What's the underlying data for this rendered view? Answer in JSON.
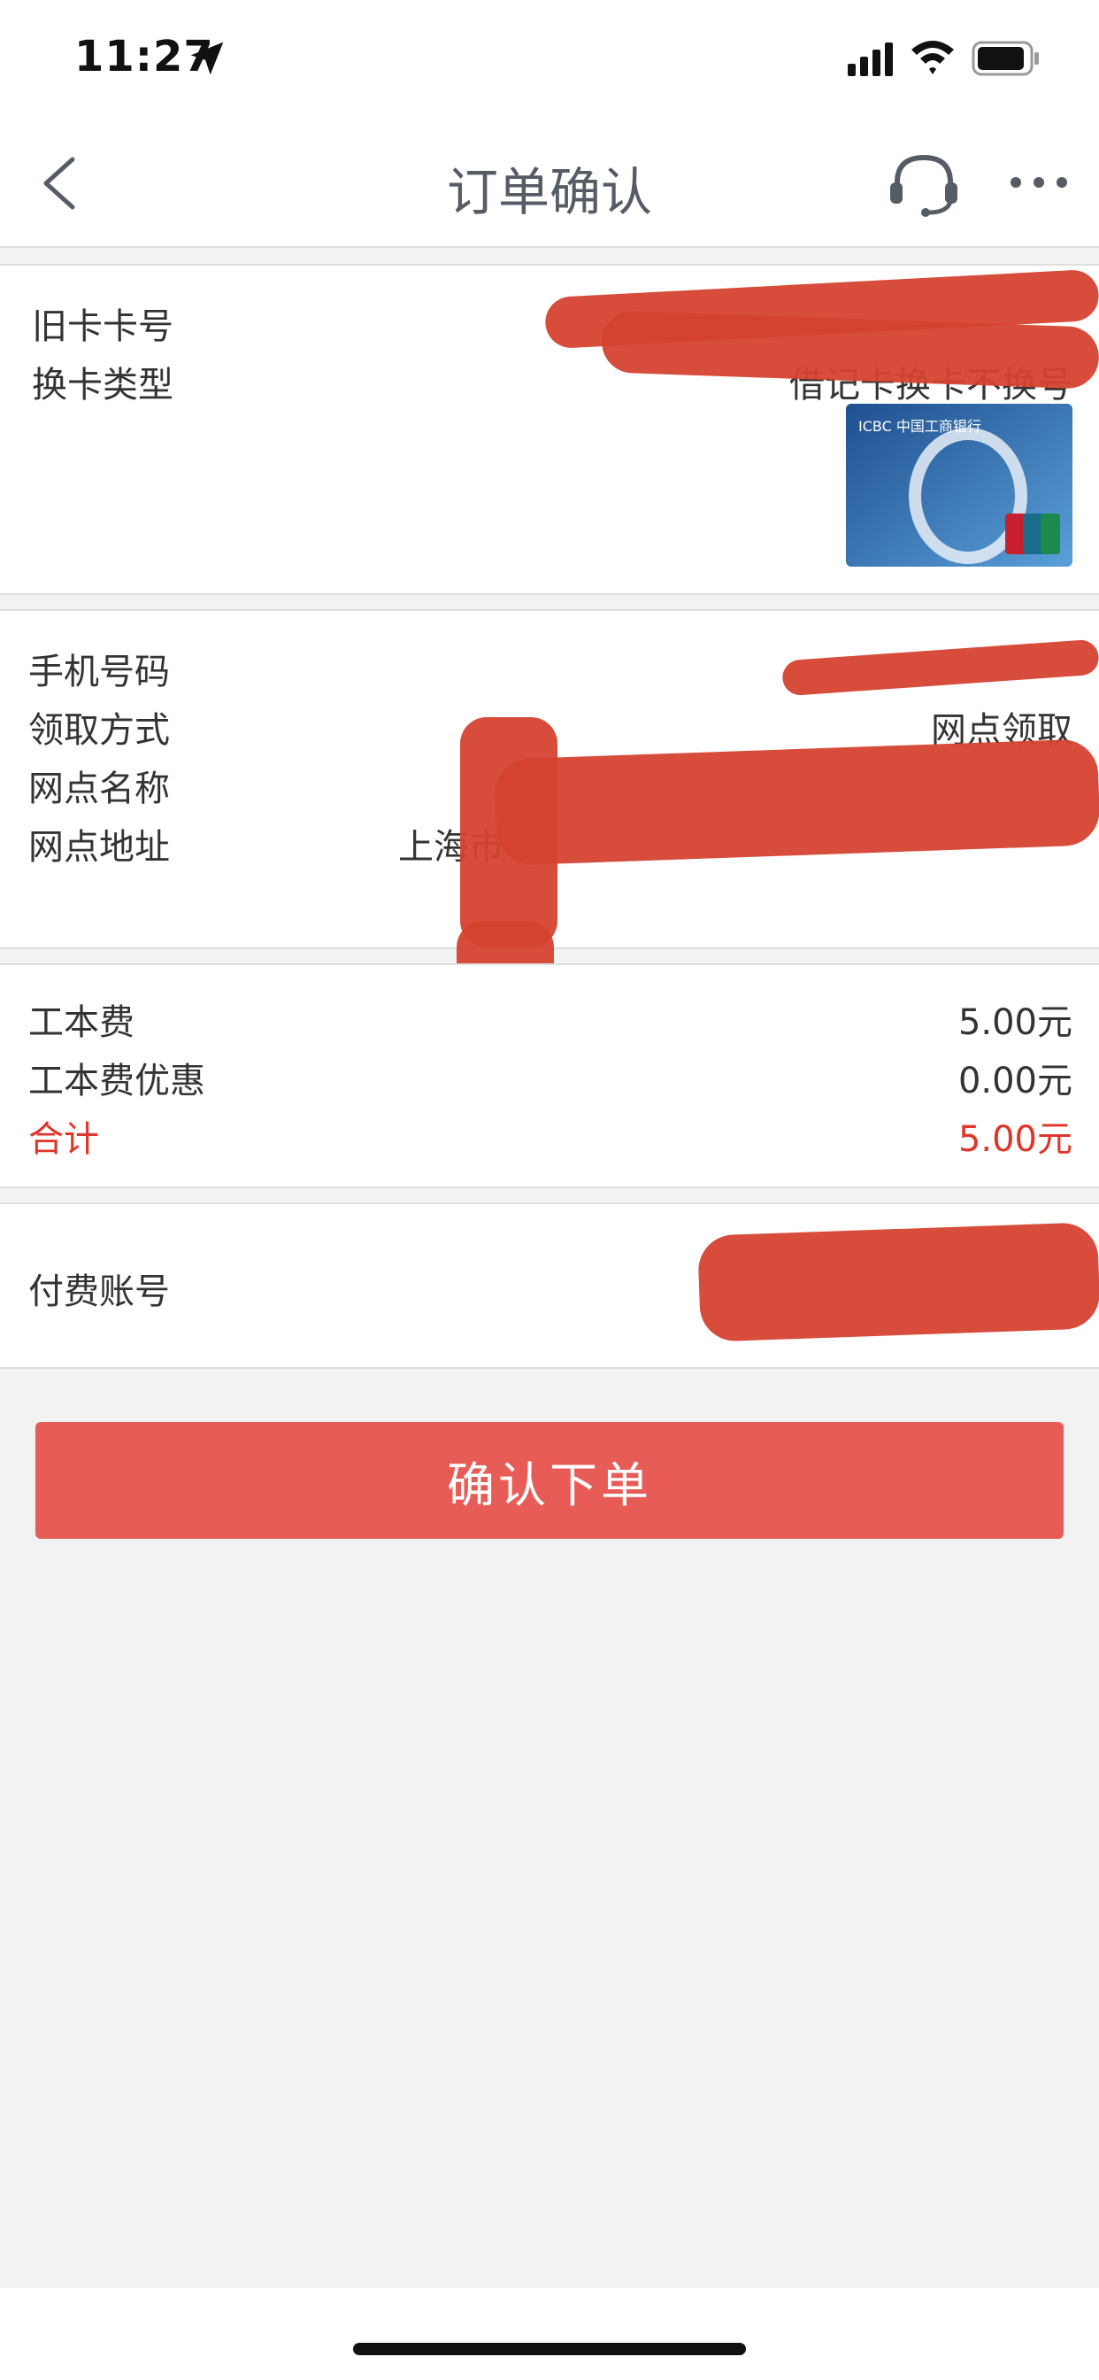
{
  "status_bar": {
    "time": "11:27"
  },
  "nav": {
    "title": "订单确认"
  },
  "card_section": {
    "old_card_label": "旧卡卡号",
    "card_type_label": "换卡类型",
    "card_type_value": "借记卡换卡不换号",
    "card_image_text": "ICBC 中国工商银行"
  },
  "pickup_section": {
    "phone_label": "手机号码",
    "method_label": "领取方式",
    "method_value": "网点领取",
    "branch_name_label": "网点名称",
    "branch_address_label": "网点地址",
    "branch_address_value": "上海市"
  },
  "fee_section": {
    "fee_label": "工本费",
    "fee_value": "5.00元",
    "discount_label": "工本费优惠",
    "discount_value": "0.00元",
    "total_label": "合计",
    "total_value": "5.00元"
  },
  "payment_section": {
    "account_label": "付费账号"
  },
  "actions": {
    "confirm_label": "确认下单"
  },
  "colors": {
    "accent_red": "#e0352b",
    "button": "#e85c58",
    "nav_title": "#555c66"
  }
}
